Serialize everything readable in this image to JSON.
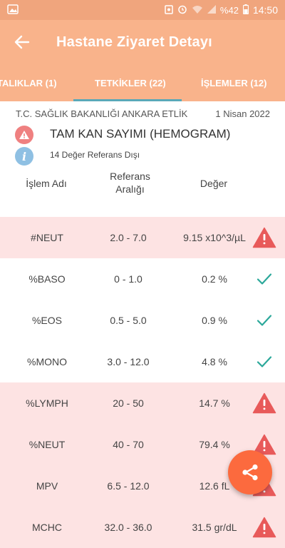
{
  "status_bar": {
    "battery": "%42",
    "time": "14:50",
    "icons": [
      "image-icon",
      "data-saver-icon",
      "alarm-icon",
      "wifi-icon",
      "signal-icon",
      "battery-icon"
    ]
  },
  "app_bar": {
    "title": "Hastane Ziyaret Detayı",
    "back_icon": "arrow-left-icon"
  },
  "tabs": [
    {
      "label": "TALIKLAR (1)"
    },
    {
      "label": "TETKİKLER (22)",
      "selected": true
    },
    {
      "label": "İŞLEMLER (12)"
    }
  ],
  "visit": {
    "hospital": "T.C. SAĞLIK BAKANLIĞI ANKARA ETLİK",
    "date": "1 Nisan 2022",
    "test_name": "TAM KAN SAYIMI (HEMOGRAM)",
    "out_of_range_summary": "14 Değer Referans Dışı"
  },
  "table": {
    "headers": {
      "name": "İşlem Adı",
      "ref_1": "Referans",
      "ref_2": "Aralığı",
      "value": "Değer"
    },
    "rows": [
      {
        "name": "#NEUT",
        "ref": "2.0 - 7.0",
        "value": "9.15 x10^3/µL",
        "status": "out"
      },
      {
        "name": "%BASO",
        "ref": "0 - 1.0",
        "value": "0.2 %",
        "status": "in"
      },
      {
        "name": "%EOS",
        "ref": "0.5 - 5.0",
        "value": "0.9 %",
        "status": "in"
      },
      {
        "name": "%MONO",
        "ref": "3.0 - 12.0",
        "value": "4.8 %",
        "status": "in"
      },
      {
        "name": "%LYMPH",
        "ref": "20 - 50",
        "value": "14.7 %",
        "status": "out"
      },
      {
        "name": "%NEUT",
        "ref": "40 - 70",
        "value": "79.4 %",
        "status": "out"
      },
      {
        "name": "MPV",
        "ref": "6.5 - 12.0",
        "value": "12.6 fL",
        "status": "out"
      },
      {
        "name": "MCHC",
        "ref": "32.0 - 36.0",
        "value": "31.5 gr/dL",
        "status": "out"
      }
    ]
  },
  "fab": {
    "icon": "share-icon"
  },
  "colors": {
    "app_bar": "#f9b38b",
    "status_bar": "#f0a57d",
    "out_of_range_row": "#fde3e3",
    "warning_red": "#e85a5a",
    "check_teal": "#2ba89a",
    "fab": "#fc6a3e",
    "tab_indicator": "#5aa8b8"
  }
}
